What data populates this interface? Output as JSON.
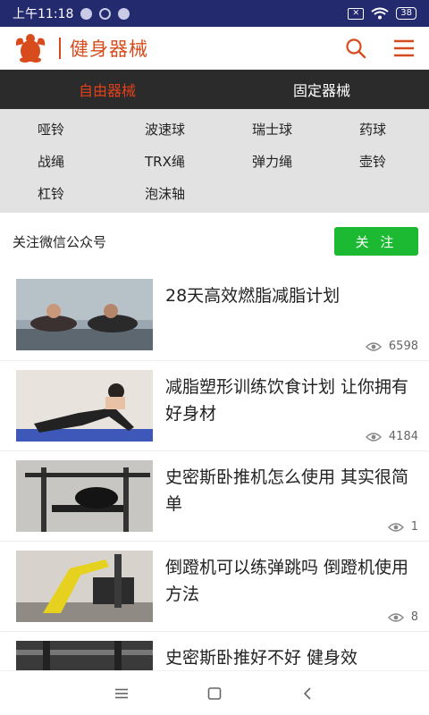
{
  "status_bar": {
    "time": "上午11:18",
    "battery": "38"
  },
  "header": {
    "title": "健身器械",
    "icons": [
      "search-icon",
      "menu-icon"
    ]
  },
  "tabs": [
    {
      "label": "自由器械",
      "active": true
    },
    {
      "label": "固定器械",
      "active": false
    }
  ],
  "categories": [
    "哑铃",
    "波速球",
    "瑞士球",
    "药球",
    "战绳",
    "TRX绳",
    "弹力绳",
    "壶铃",
    "杠铃",
    "泡沫轴"
  ],
  "follow": {
    "text": "关注微信公众号",
    "button_label": "关 注"
  },
  "articles": [
    {
      "title": "28天高效燃脂减脂计划",
      "views": "6598"
    },
    {
      "title": "减脂塑形训练饮食计划 让你拥有好身材",
      "views": "4184"
    },
    {
      "title": "史密斯卧推机怎么使用 其实很简单",
      "views": "1"
    },
    {
      "title": "倒蹬机可以练弹跳吗 倒蹬机使用方法",
      "views": "8"
    },
    {
      "title": "史密斯卧推好不好 健身效",
      "views": ""
    }
  ],
  "colors": {
    "status_bar": "#232a6e",
    "brand": "#d84b1c",
    "tab_active": "#e0411b",
    "tab_bg": "#2b2b2b",
    "category_bg": "#e2e2e2",
    "follow_button": "#1cba32"
  }
}
